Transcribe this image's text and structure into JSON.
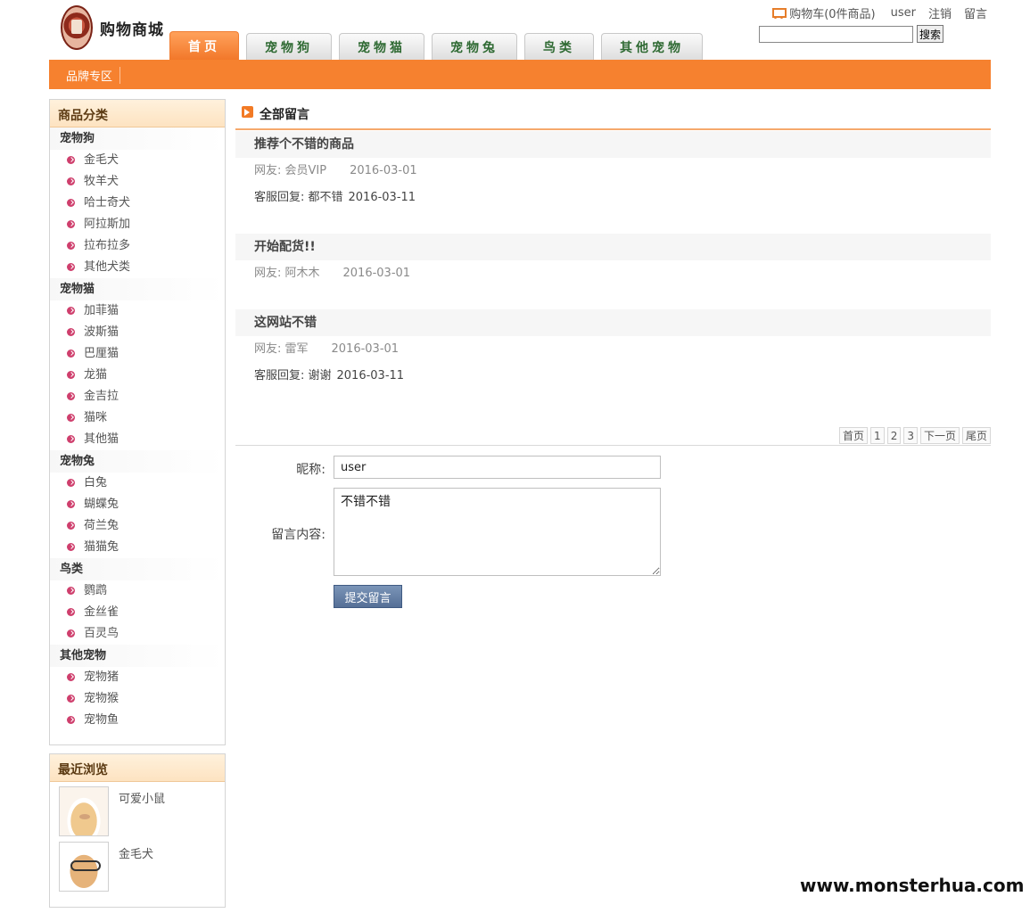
{
  "header": {
    "logo_text": "购物商城",
    "tabs": [
      "首页",
      "宠物狗",
      "宠物猫",
      "宠物兔",
      "鸟类",
      "其他宠物"
    ],
    "cart_label": "购物车(0件商品)",
    "user": "user",
    "logout": "注销",
    "guestbook": "留言",
    "search_value": "",
    "search_button": "搜索"
  },
  "nav_bar": {
    "brand_link": "品牌专区"
  },
  "sidebar": {
    "categories_title": "商品分类",
    "groups": [
      {
        "title": "宠物狗",
        "items": [
          "金毛犬",
          "牧羊犬",
          "哈士奇犬",
          "阿拉斯加",
          "拉布拉多",
          "其他犬类"
        ]
      },
      {
        "title": "宠物猫",
        "items": [
          "加菲猫",
          "波斯猫",
          "巴厘猫",
          "龙猫",
          "金吉拉",
          "猫咪",
          "其他猫"
        ]
      },
      {
        "title": "宠物兔",
        "items": [
          "白兔",
          "蝴蝶兔",
          "荷兰兔",
          "猫猫兔"
        ]
      },
      {
        "title": "鸟类",
        "items": [
          "鹦鹉",
          "金丝雀",
          "百灵鸟"
        ]
      },
      {
        "title": "其他宠物",
        "items": [
          "宠物猪",
          "宠物猴",
          "宠物鱼"
        ]
      }
    ],
    "recent_title": "最近浏览",
    "recent": [
      {
        "name": "可爱小鼠",
        "image": "guinea-pig-photo"
      },
      {
        "name": "金毛犬",
        "image": "dog-with-glasses-photo"
      }
    ]
  },
  "main": {
    "title": "全部留言",
    "messages": [
      {
        "title": "推荐个不错的商品",
        "author": "网友: 会员VIP",
        "date": "2016-03-01",
        "reply_label": "客服回复: 都不错",
        "reply_date": "2016-03-11"
      },
      {
        "title": "开始配货!!",
        "author": "网友: 阿木木",
        "date": "2016-03-01",
        "reply_label": "",
        "reply_date": ""
      },
      {
        "title": "这网站不错",
        "author": "网友: 雷军",
        "date": "2016-03-01",
        "reply_label": "客服回复: 谢谢",
        "reply_date": "2016-03-11"
      }
    ],
    "pager": [
      "首页",
      "1",
      "2",
      "3",
      "下一页",
      "尾页"
    ],
    "form": {
      "nickname_label": "昵称:",
      "nickname_value": "user",
      "content_label": "留言内容:",
      "content_value": "不错不错",
      "submit_label": "提交留言"
    }
  },
  "watermark": "www.monsterhua.com",
  "colors": {
    "accent": "#f6812f",
    "submit": "#5b759b",
    "bullet": "#cf3f6d"
  }
}
